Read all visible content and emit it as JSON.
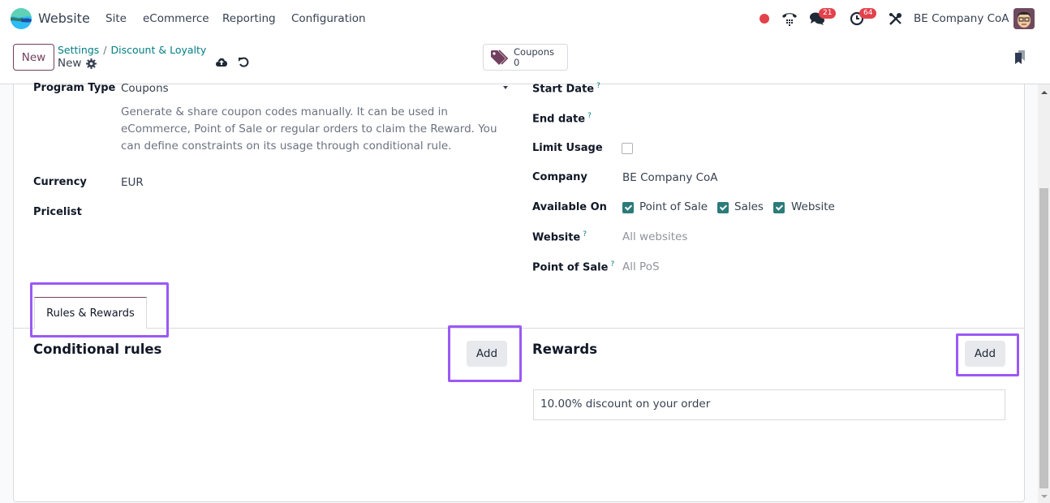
{
  "navbar": {
    "app_name": "Website",
    "menu": [
      "Site",
      "eCommerce",
      "Reporting",
      "Configuration"
    ],
    "messages_count": "21",
    "activities_count": "64",
    "company": "BE Company CoA",
    "colors": {
      "recording_dot": "#e2424b",
      "badge": "#e2424b"
    }
  },
  "control_panel": {
    "new_label": "New",
    "breadcrumb": [
      "Settings",
      "Discount & Loyalty"
    ],
    "breadcrumb_sep": "/",
    "record_name": "New",
    "smart_button": {
      "label": "Coupons",
      "value": "0"
    }
  },
  "form": {
    "left": {
      "program_type": {
        "label": "Program Type",
        "value": "Coupons",
        "description": "Generate & share coupon codes manually. It can be used in eCommerce, Point of Sale or regular orders to claim the Reward. You can define constraints on its usage through conditional rule."
      },
      "currency": {
        "label": "Currency",
        "value": "EUR"
      },
      "pricelist": {
        "label": "Pricelist",
        "value": ""
      }
    },
    "right": {
      "start_date": {
        "label": "Start Date",
        "help": "?"
      },
      "end_date": {
        "label": "End date",
        "help": "?"
      },
      "limit_usage": {
        "label": "Limit Usage",
        "checked": false
      },
      "company": {
        "label": "Company",
        "value": "BE Company CoA"
      },
      "available_on": {
        "label": "Available On",
        "options": [
          {
            "label": "Point of Sale",
            "checked": true
          },
          {
            "label": "Sales",
            "checked": true
          },
          {
            "label": "Website",
            "checked": true
          }
        ]
      },
      "website": {
        "label": "Website",
        "help": "?",
        "placeholder": "All websites"
      },
      "point_of_sale": {
        "label": "Point of Sale",
        "help": "?",
        "placeholder": "All PoS"
      }
    },
    "tabs": [
      {
        "label": "Rules & Rewards",
        "active": true
      }
    ],
    "conditional_rules": {
      "title": "Conditional rules",
      "add_label": "Add"
    },
    "rewards": {
      "title": "Rewards",
      "add_label": "Add",
      "items": [
        "10.00% discount on your order"
      ]
    }
  },
  "highlight_color": "#9b59f6"
}
